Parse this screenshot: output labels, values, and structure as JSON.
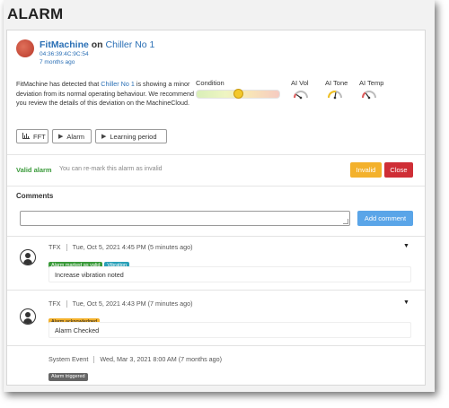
{
  "page": {
    "title": "ALARM"
  },
  "machine": {
    "name": "FitMachine",
    "on_text": "on",
    "location": "Chiller No 1",
    "mac": "04:36:39:4C:9C:54",
    "age": "7 months ago"
  },
  "description": {
    "part1": "FitMachine has detected that ",
    "link": "Chiller No 1",
    "part2": " is showing a minor deviation from its normal operating behaviour. We recommend you review the details of this deviation on the MachineCloud."
  },
  "condition": {
    "label": "Condition",
    "level": 0.5
  },
  "gauges": [
    {
      "label": "AI Vol",
      "value": 0.2,
      "color": "#e05a5a"
    },
    {
      "label": "AI Tone",
      "value": 0.55,
      "color": "#f0c020"
    },
    {
      "label": "AI Temp",
      "value": 0.3,
      "color": "#e05a5a"
    }
  ],
  "view_buttons": [
    {
      "label": "FFT",
      "icon": "chart-icon"
    },
    {
      "label": "Alarm",
      "icon": "play-icon"
    },
    {
      "label": "Learning period",
      "icon": "play-icon"
    }
  ],
  "validation": {
    "status": "Valid alarm",
    "hint": "You can re-mark this alarm as invalid",
    "invalid_label": "Invalid",
    "close_label": "Close"
  },
  "comments": {
    "title": "Comments",
    "input_value": "",
    "add_label": "Add comment",
    "entries": [
      {
        "user": "TFX",
        "time": "Tue, Oct 5, 2021 4:45 PM (5 minutes ago)",
        "badges": [
          {
            "label": "Alarm marked as valid",
            "color": "#3a9a3a"
          },
          {
            "label": "Vibration",
            "color": "#2aa0b8"
          }
        ],
        "text": "Increase vibration noted"
      },
      {
        "user": "TFX",
        "time": "Tue, Oct 5, 2021 4:43 PM (7 minutes ago)",
        "badges": [
          {
            "label": "Alarm acknowledged",
            "color": "#f3b12c"
          }
        ],
        "text": "Alarm Checked"
      },
      {
        "user": "System Event",
        "time": "Wed, Mar 3, 2021 8:00 AM (7 months ago)",
        "badges": [
          {
            "label": "Alarm triggered",
            "color": "#666666"
          }
        ],
        "text": ""
      }
    ]
  }
}
